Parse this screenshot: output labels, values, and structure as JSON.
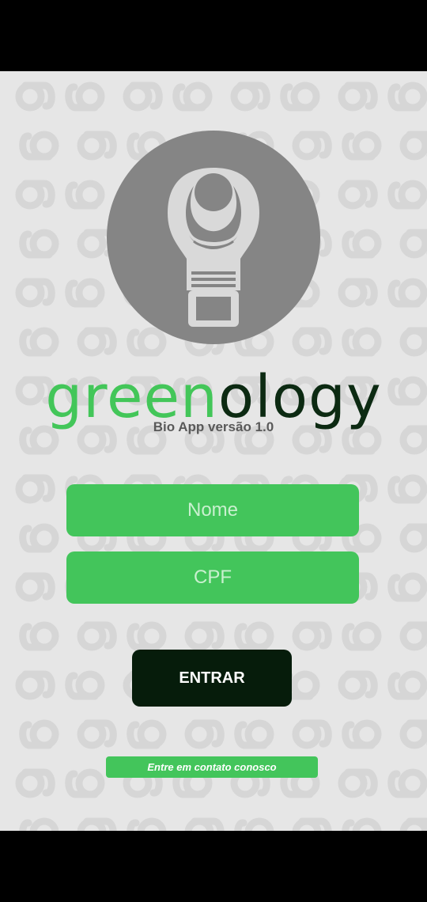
{
  "app": {
    "brand_part1": "green",
    "brand_part2": "ology",
    "version": "Bio App versão 1.0",
    "pattern_text": "greenology"
  },
  "form": {
    "name_placeholder": "Nome",
    "name_value": "",
    "cpf_placeholder": "CPF",
    "cpf_value": "",
    "submit_label": "ENTRAR",
    "contact_label": "Entre em contato conosco"
  },
  "icons": {
    "logo": "lightbulb-icon"
  },
  "colors": {
    "green": "#43c55b",
    "dark_green": "#061c0b",
    "background": "#e6e6e6",
    "logo_gray": "#858585"
  }
}
